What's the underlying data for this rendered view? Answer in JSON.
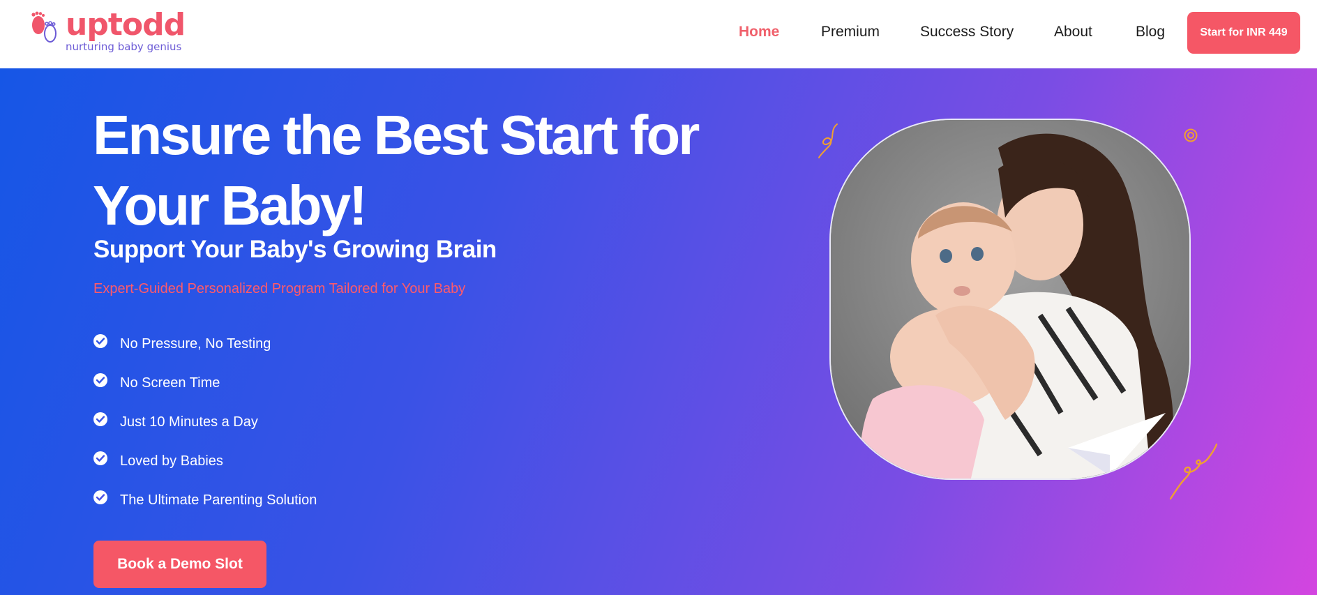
{
  "brand": {
    "name": "uptodd",
    "tagline": "nurturing baby genius",
    "colors": {
      "accent": "#f55766",
      "brand_purple": "#6c5bd6"
    }
  },
  "nav": {
    "items": [
      {
        "label": "Home",
        "active": true
      },
      {
        "label": "Premium",
        "active": false
      },
      {
        "label": "Success Story",
        "active": false
      },
      {
        "label": "About",
        "active": false
      },
      {
        "label": "Blog",
        "active": false
      }
    ],
    "cta_label": "Start for INR 449"
  },
  "hero": {
    "title": "Ensure the Best Start for Your Baby!",
    "subtitle": "Support Your Baby's Growing Brain",
    "tagline": "Expert-Guided Personalized Program Tailored for Your Baby",
    "features": [
      "No Pressure, No Testing",
      "No Screen Time",
      "Just 10 Minutes a Day",
      "Loved by Babies",
      "The Ultimate Parenting Solution"
    ],
    "cta_label": "Book a Demo Slot",
    "image": "mother-holding-baby-photo",
    "colors": {
      "gradient_start": "#1656e6",
      "gradient_end": "#d345e0"
    }
  }
}
